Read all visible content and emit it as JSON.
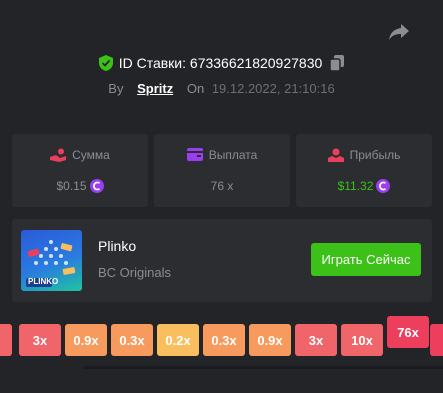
{
  "header": {
    "id_label": "ID Ставки: 67336621820927830",
    "by_label": "By",
    "user": "Spritz",
    "on_label": "On",
    "datetime": "19.12.2022, 21:10:16"
  },
  "stats": [
    {
      "label": "Сумма",
      "value": "$0.15",
      "icon": "hand-coin-icon"
    },
    {
      "label": "Выплата",
      "value": "76 x",
      "icon": "wallet-icon"
    },
    {
      "label": "Прибыль",
      "value": "$11.32",
      "icon": "profit-icon"
    }
  ],
  "game": {
    "name": "Plinko",
    "provider": "BC Originals",
    "play_label": "Играть Сейчас",
    "thumb_text": "PLINKO"
  },
  "multipliers": [
    "3x",
    "0.9x",
    "0.3x",
    "0.2x",
    "0.3x",
    "0.9x",
    "3x",
    "10x",
    "76x"
  ],
  "selected_multiplier": "76x",
  "colors": {
    "background": "#232427",
    "card": "#2c2d31",
    "accent_green": "#3bc117",
    "coin": "#9b3df0",
    "slot_red": "#f0656a",
    "slot_orange": "#f79a5e",
    "slot_yellow": "#f9bf5e",
    "slot_selected": "#ee3e5e"
  }
}
